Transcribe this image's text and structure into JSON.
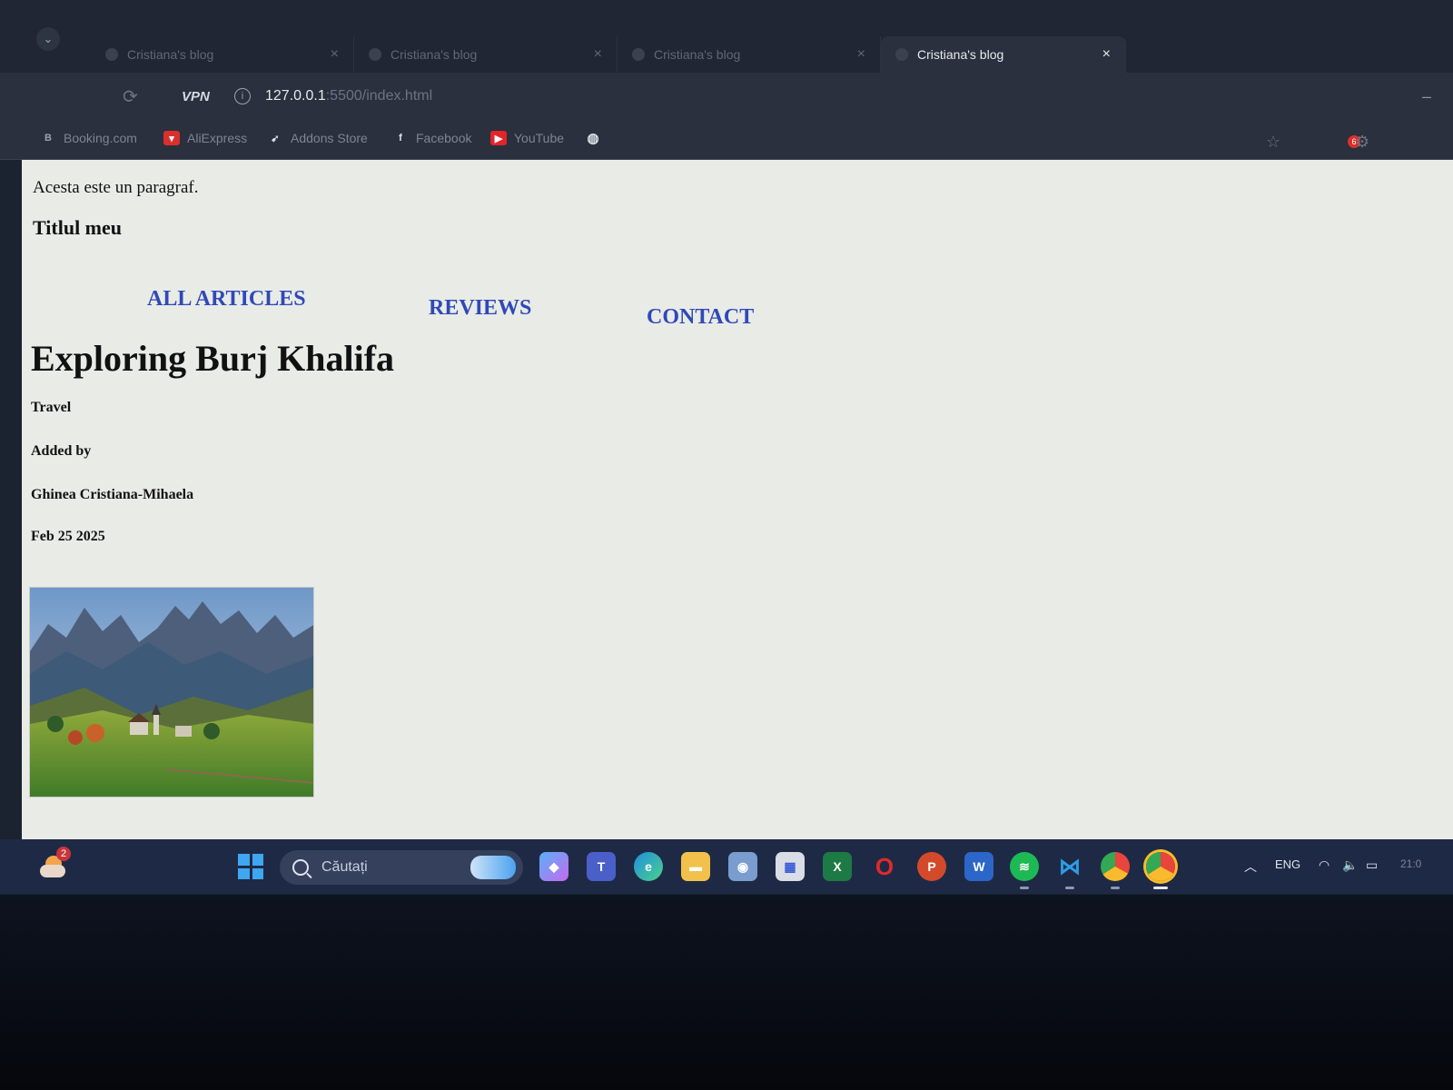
{
  "browser": {
    "tabs": [
      {
        "title": "Cristiana's blog",
        "active": false
      },
      {
        "title": "Cristiana's blog",
        "active": false
      },
      {
        "title": "Cristiana's blog",
        "active": true
      }
    ],
    "url_host": "127.0.0.1",
    "url_path": ":5500/index.html",
    "vpn_label": "VPN",
    "bookmarks": [
      {
        "label": "Booking.com",
        "icon": "booking-icon",
        "color": "#2a303d"
      },
      {
        "label": "AliExpress",
        "icon": "aliexpress-icon",
        "color": "#d9302c"
      },
      {
        "label": "Addons Store",
        "icon": "addons-icon",
        "color": "#2a303d"
      },
      {
        "label": "Facebook",
        "icon": "facebook-icon",
        "color": "#2a303d"
      },
      {
        "label": "YouTube",
        "icon": "youtube-icon",
        "color": "#e3242b"
      }
    ],
    "notification_count": "6"
  },
  "page": {
    "paragraph": "Acesta este un paragraf.",
    "my_title": "Titlul meu",
    "nav": [
      "ALL ARTICLES",
      "REVIEWS",
      "CONTACT"
    ],
    "article_title": "Exploring Burj Khalifa",
    "category": "Travel",
    "added_by_label": "Added by",
    "author": "Ghinea Cristiana-Mihaela",
    "date": "Feb 25 2025",
    "link_color": "#2f49b8"
  },
  "taskbar": {
    "search_placeholder": "Căutați",
    "weather_badge": "2",
    "language": "ENG",
    "clock": "21:0"
  }
}
